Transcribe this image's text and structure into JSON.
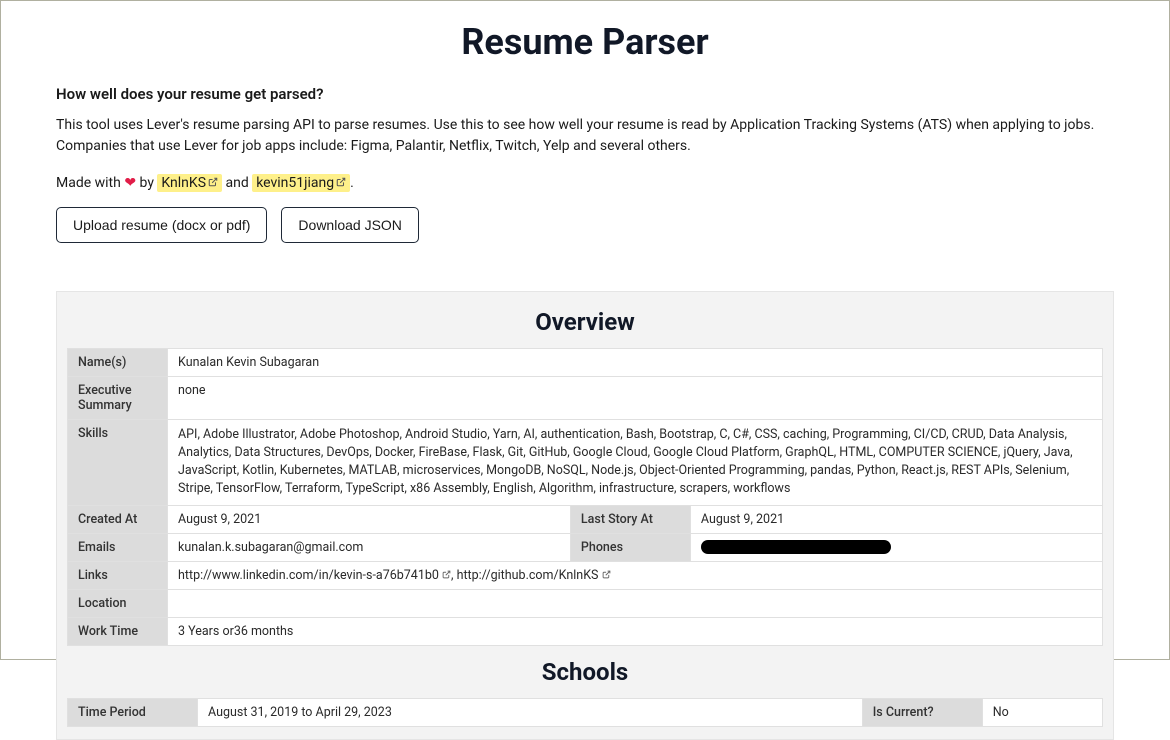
{
  "header": {
    "title": "Resume Parser",
    "subtitle": "How well does your resume get parsed?",
    "description": "This tool uses Lever's resume parsing API to parse resumes. Use this to see how well your resume is read by Application Tracking Systems (ATS) when applying to jobs. Companies that use Lever for job apps include: Figma, Palantir, Netflix, Twitch, Yelp and several others.",
    "credits_prefix": "Made with ",
    "credits_by": " by ",
    "credits_and": " and ",
    "credits_period": ".",
    "author1": "KnlnKS",
    "author2": "kevin51jiang"
  },
  "buttons": {
    "upload": "Upload resume (docx or pdf)",
    "download": "Download JSON"
  },
  "overview": {
    "title": "Overview",
    "labels": {
      "names": "Name(s)",
      "exec_summary": "Executive Summary",
      "skills": "Skills",
      "created_at": "Created At",
      "last_story_at": "Last Story At",
      "emails": "Emails",
      "phones": "Phones",
      "links": "Links",
      "location": "Location",
      "work_time": "Work Time"
    },
    "values": {
      "names": "Kunalan Kevin Subagaran",
      "exec_summary": "none",
      "skills": "API, Adobe Illustrator, Adobe Photoshop, Android Studio, Yarn, AI, authentication, Bash, Bootstrap, C, C#, CSS, caching, Programming, CI/CD, CRUD, Data Analysis, Analytics, Data Structures, DevOps, Docker, FireBase, Flask, Git, GitHub, Google Cloud, Google Cloud Platform, GraphQL, HTML, COMPUTER SCIENCE, jQuery, Java, JavaScript, Kotlin, Kubernetes, MATLAB, microservices, MongoDB, NoSQL, Node.js, Object-Oriented Programming, pandas, Python, React.js, REST APIs, Selenium, Stripe, TensorFlow, Terraform, TypeScript, x86 Assembly, English, Algorithm, infrastructure, scrapers, workflows",
      "created_at": "August 9, 2021",
      "last_story_at": "August 9, 2021",
      "emails": "kunalan.k.subagaran@gmail.com",
      "link1": "http://www.linkedin.com/in/kevin-s-a76b741b0",
      "link_sep": ", ",
      "link2": "http://github.com/KnlnKS",
      "location": "",
      "work_time": "3 Years or36 months"
    }
  },
  "schools": {
    "title": "Schools",
    "labels": {
      "time_period": "Time Period",
      "is_current": "Is Current?"
    },
    "values": {
      "time_period": "August 31, 2019 to April 29, 2023",
      "is_current": "No"
    }
  }
}
